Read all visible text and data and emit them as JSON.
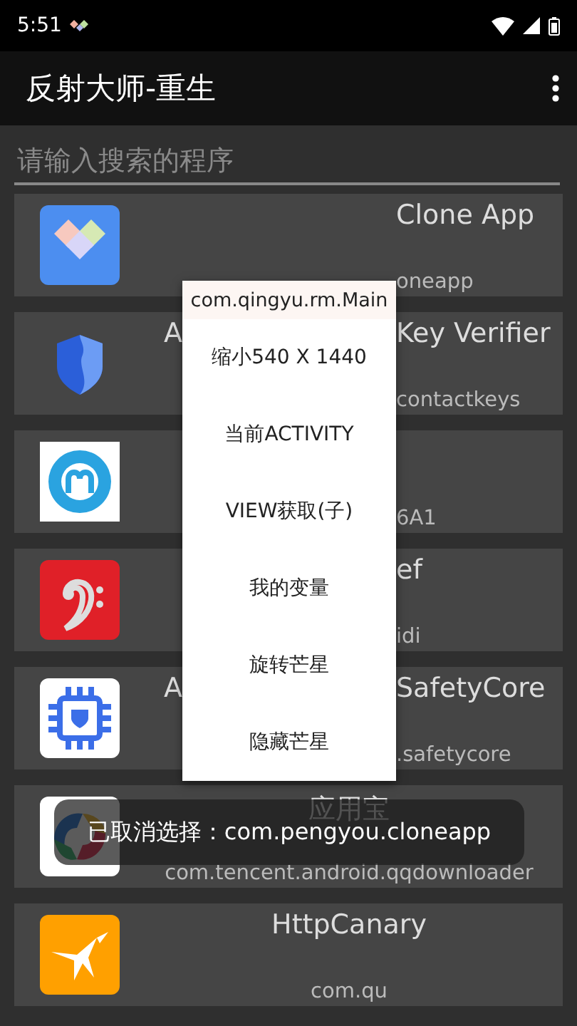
{
  "status_bar": {
    "time": "5:51"
  },
  "app_bar": {
    "title": "反射大师-重生"
  },
  "search": {
    "placeholder": "请输入搜索的程序"
  },
  "apps": [
    {
      "kind": "clipped",
      "title": "Clone App",
      "subtitle": "oneapp"
    },
    {
      "kind": "clipped",
      "title_left": "A",
      "title": "Key Verifier",
      "subtitle": "contactkeys"
    },
    {
      "kind": "clipped",
      "subtitle": "6A1"
    },
    {
      "kind": "clipped",
      "title": "ef",
      "subtitle": "idi"
    },
    {
      "kind": "clipped",
      "title_left": "A",
      "title": "SafetyCore",
      "subtitle": ".safetycore"
    },
    {
      "kind": "full",
      "title": "应用宝",
      "subtitle": "com.tencent.android.qqdownloader"
    },
    {
      "kind": "full",
      "title": "HttpCanary",
      "subtitle": "com.qu"
    }
  ],
  "popup_menu": {
    "header": "com.qingyu.rm.Main",
    "items": [
      "缩小540 X 1440",
      "当前ACTIVITY",
      "VIEW获取(子)",
      "我的变量",
      "旋转芒星",
      "隐藏芒星"
    ]
  },
  "toast": {
    "text": "已取消选择：com.pengyou.cloneapp"
  }
}
